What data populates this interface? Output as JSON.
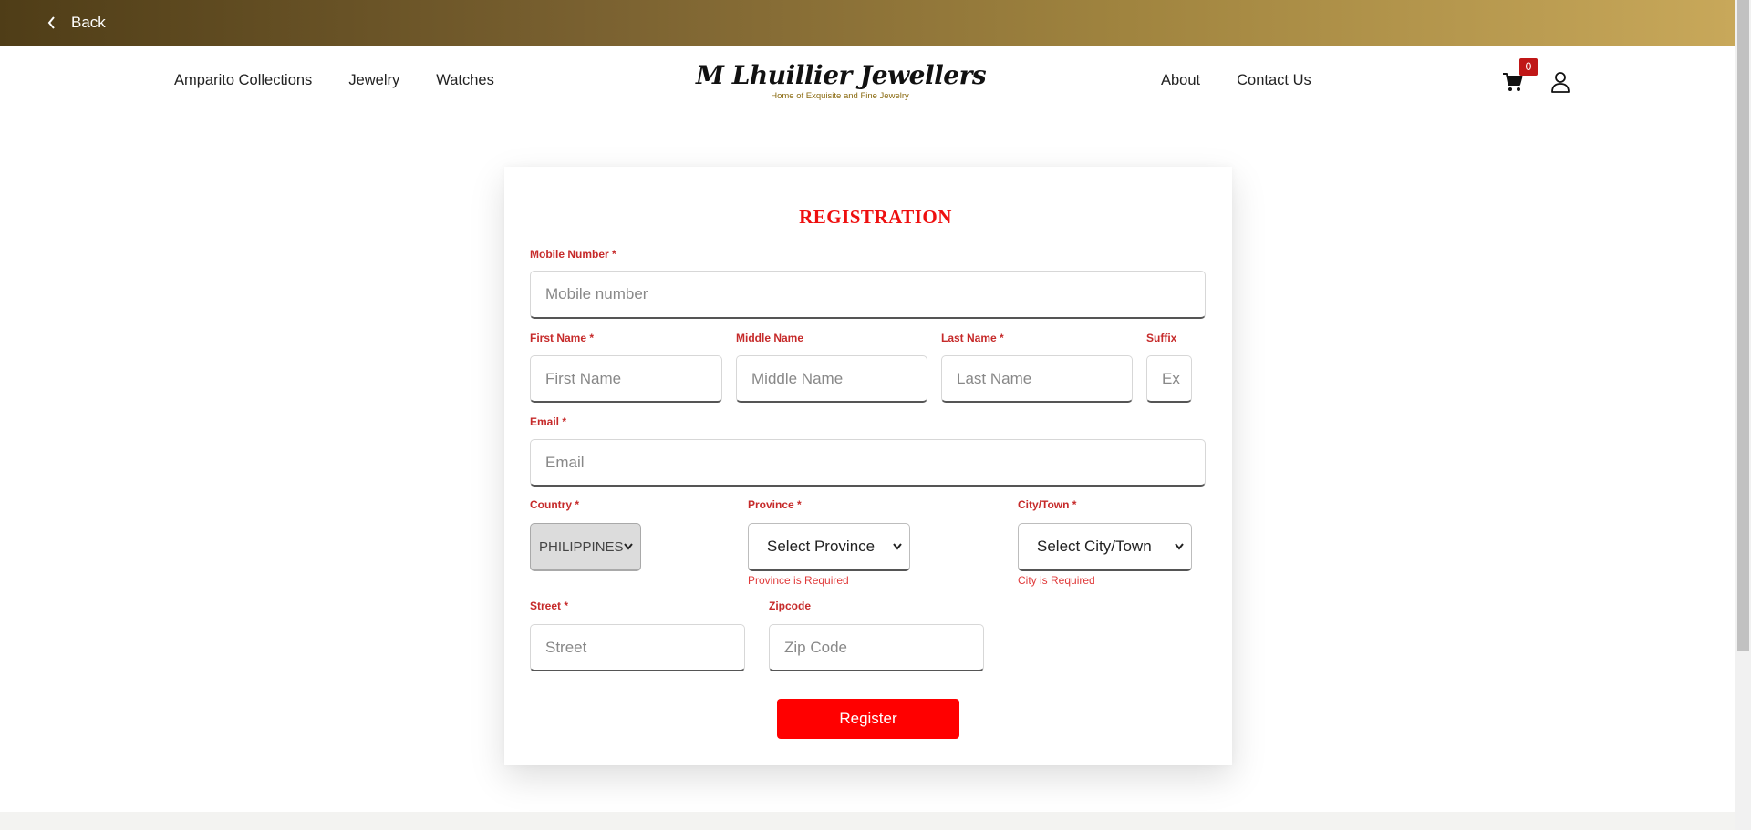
{
  "topbar": {
    "back_label": "Back"
  },
  "nav": {
    "left": [
      "Amparito Collections",
      "Jewelry",
      "Watches"
    ],
    "right": [
      "About",
      "Contact Us"
    ]
  },
  "logo": {
    "name": "M Lhuillier Jewellers",
    "tagline": "Home of Exquisite and Fine Jewelry"
  },
  "cart": {
    "count": "0"
  },
  "form": {
    "title": "REGISTRATION",
    "mobile": {
      "label": "Mobile Number *",
      "placeholder": "Mobile number"
    },
    "first_name": {
      "label": "First Name *",
      "placeholder": "First Name"
    },
    "middle_name": {
      "label": "Middle Name",
      "placeholder": "Middle Name"
    },
    "last_name": {
      "label": "Last Name *",
      "placeholder": "Last Name"
    },
    "suffix": {
      "label": "Suffix",
      "placeholder": "Ex"
    },
    "email": {
      "label": "Email *",
      "placeholder": "Email"
    },
    "country": {
      "label": "Country *",
      "value": "PHILIPPINES"
    },
    "province": {
      "label": "Province *",
      "value": "Select Province",
      "error": "Province is Required"
    },
    "city": {
      "label": "City/Town *",
      "value": "Select City/Town",
      "error": "City is Required"
    },
    "street": {
      "label": "Street *",
      "placeholder": "Street"
    },
    "zipcode": {
      "label": "Zipcode",
      "placeholder": "Zip Code"
    },
    "submit_label": "Register"
  },
  "colors": {
    "accent_red": "#ff0000",
    "label_red": "#c62a2a",
    "gold_start": "#4f3d17",
    "gold_end": "#c8a85a"
  }
}
